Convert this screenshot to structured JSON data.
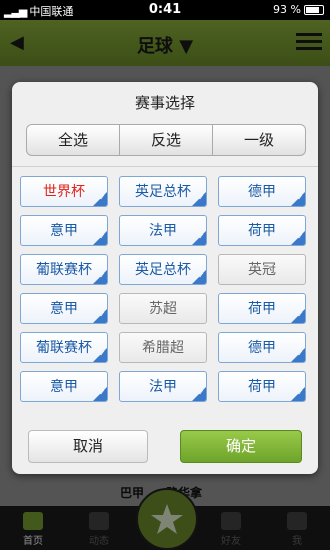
{
  "status": {
    "carrier": "中国联通",
    "time": "0:41",
    "battery": "93 %",
    "battery_level": 0.93
  },
  "nav": {
    "title": "足球 ▼"
  },
  "background": {
    "text": "巴甲 ... 路华拿"
  },
  "dialog": {
    "title": "赛事选择",
    "segments": [
      "全选",
      "反选",
      "一级"
    ],
    "leagues": [
      {
        "label": "世界杯",
        "selected": true,
        "color": "#e2231a"
      },
      {
        "label": "英足总杯",
        "selected": true
      },
      {
        "label": "德甲",
        "selected": true
      },
      {
        "label": "意甲",
        "selected": true
      },
      {
        "label": "法甲",
        "selected": true
      },
      {
        "label": "荷甲",
        "selected": true
      },
      {
        "label": "葡联赛杯",
        "selected": true
      },
      {
        "label": "英足总杯",
        "selected": true
      },
      {
        "label": "英冠",
        "selected": false
      },
      {
        "label": "意甲",
        "selected": true
      },
      {
        "label": "苏超",
        "selected": false
      },
      {
        "label": "荷甲",
        "selected": true
      },
      {
        "label": "葡联赛杯",
        "selected": true
      },
      {
        "label": "希腊超",
        "selected": false
      },
      {
        "label": "德甲",
        "selected": true
      },
      {
        "label": "意甲",
        "selected": true
      },
      {
        "label": "法甲",
        "selected": true
      },
      {
        "label": "荷甲",
        "selected": true
      }
    ],
    "cancel_label": "取消",
    "confirm_label": "确定"
  },
  "tabs": [
    {
      "label": "首页",
      "icon": "home-icon",
      "active": true
    },
    {
      "label": "动态",
      "icon": "megaphone-icon",
      "active": false
    },
    {
      "label": "",
      "icon": "star-icon",
      "active": false
    },
    {
      "label": "好友",
      "icon": "friends-icon",
      "active": false
    },
    {
      "label": "我",
      "icon": "user-icon",
      "active": false
    }
  ],
  "colors": {
    "accent": "#7aa332",
    "chip_text": "#1a5aa6",
    "check": "#3a78c9"
  }
}
